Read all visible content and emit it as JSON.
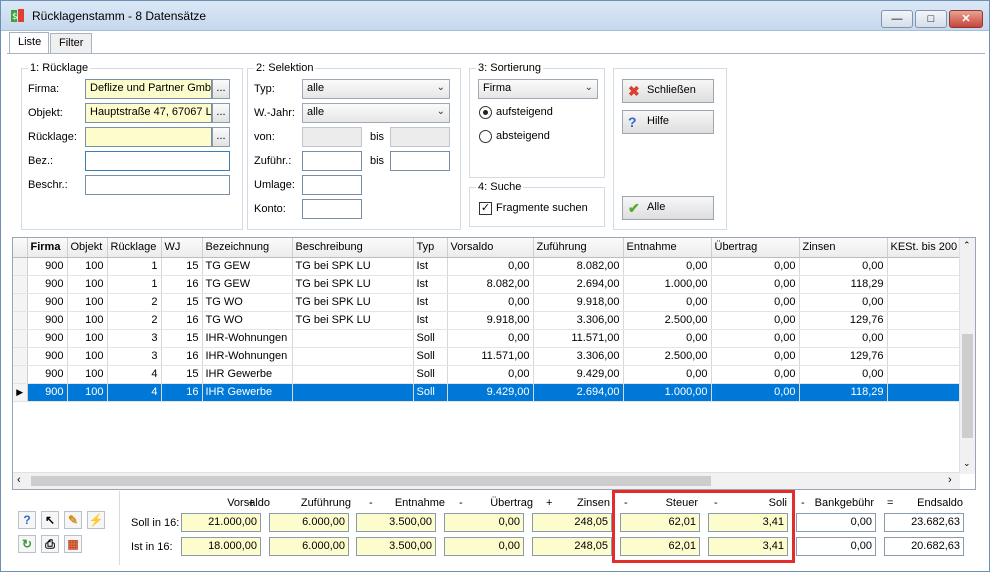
{
  "window": {
    "title": "Rücklagenstamm - 8 Datensätze"
  },
  "tabs": [
    "Liste",
    "Filter"
  ],
  "ruecklage": {
    "legend": "1: Rücklage",
    "firma_label": "Firma:",
    "firma_value": "Deflize und Partner GmbH",
    "objekt_label": "Objekt:",
    "objekt_value": "Hauptstraße 47, 67067 L",
    "ruecklage_label": "Rücklage:",
    "ruecklage_value": "",
    "bez_label": "Bez.:",
    "bez_value": "",
    "beschr_label": "Beschr.:",
    "beschr_value": "",
    "dots": "..."
  },
  "selektion": {
    "legend": "2: Selektion",
    "typ_label": "Typ:",
    "typ_value": "alle",
    "wjahr_label": "W.-Jahr:",
    "wjahr_value": "alle",
    "von_label": "von:",
    "bis_label": "bis",
    "zufuehr_label": "Zuführ.:",
    "bis2_label": "bis",
    "umlage_label": "Umlage:",
    "konto_label": "Konto:"
  },
  "sortierung": {
    "legend": "3: Sortierung",
    "field_value": "Firma",
    "asc_label": "aufsteigend",
    "desc_label": "absteigend"
  },
  "suche": {
    "legend": "4: Suche",
    "fragmente_label": "Fragmente suchen"
  },
  "buttons": {
    "close": "Schließen",
    "help": "Hilfe",
    "all": "Alle"
  },
  "grid": {
    "columns": [
      "Firma",
      "Objekt",
      "Rücklage",
      "WJ",
      "Bezeichnung",
      "Beschreibung",
      "Typ",
      "Vorsaldo",
      "Zuführung",
      "Entnahme",
      "Übertrag",
      "Zinsen",
      "KESt. bis 200"
    ],
    "rows": [
      [
        "900",
        "100",
        "1",
        "15",
        "TG GEW",
        "TG bei SPK LU",
        "Ist",
        "0,00",
        "8.082,00",
        "0,00",
        "0,00",
        "0,00"
      ],
      [
        "900",
        "100",
        "1",
        "16",
        "TG GEW",
        "TG bei SPK LU",
        "Ist",
        "8.082,00",
        "2.694,00",
        "1.000,00",
        "0,00",
        "118,29"
      ],
      [
        "900",
        "100",
        "2",
        "15",
        "TG WO",
        "TG bei SPK LU",
        "Ist",
        "0,00",
        "9.918,00",
        "0,00",
        "0,00",
        "0,00"
      ],
      [
        "900",
        "100",
        "2",
        "16",
        "TG WO",
        "TG bei SPK LU",
        "Ist",
        "9.918,00",
        "3.306,00",
        "2.500,00",
        "0,00",
        "129,76"
      ],
      [
        "900",
        "100",
        "3",
        "15",
        "IHR-Wohnungen",
        "",
        "Soll",
        "0,00",
        "11.571,00",
        "0,00",
        "0,00",
        "0,00"
      ],
      [
        "900",
        "100",
        "3",
        "16",
        "IHR-Wohnungen",
        "",
        "Soll",
        "11.571,00",
        "3.306,00",
        "2.500,00",
        "0,00",
        "129,76"
      ],
      [
        "900",
        "100",
        "4",
        "15",
        "IHR Gewerbe",
        "",
        "Soll",
        "0,00",
        "9.429,00",
        "0,00",
        "0,00",
        "0,00"
      ],
      [
        "900",
        "100",
        "4",
        "16",
        "IHR Gewerbe",
        "",
        "Soll",
        "9.429,00",
        "2.694,00",
        "1.000,00",
        "0,00",
        "118,29"
      ]
    ],
    "selected_row": 7
  },
  "summary": {
    "headers": [
      "Vorsaldo",
      "+",
      "Zuführung",
      "-",
      "Entnahme",
      "-",
      "Übertrag",
      "+",
      "Zinsen",
      "-",
      "Steuer",
      "-",
      "Soli",
      "-",
      "Bankgebühr",
      "=",
      "Endsaldo"
    ],
    "soll_label": "Soll in 16:",
    "ist_label": "Ist in 16:",
    "soll_values": [
      "21.000,00",
      "6.000,00",
      "3.500,00",
      "0,00",
      "248,05",
      "62,01",
      "3,41",
      "0,00",
      "23.682,63"
    ],
    "ist_values": [
      "18.000,00",
      "6.000,00",
      "3.500,00",
      "0,00",
      "248,05",
      "62,01",
      "3,41",
      "0,00",
      "20.682,63"
    ]
  },
  "colors": {
    "selection": "#0078d7",
    "input_yellow": "#fdfccd",
    "highlight_box": "#e32c2c"
  }
}
